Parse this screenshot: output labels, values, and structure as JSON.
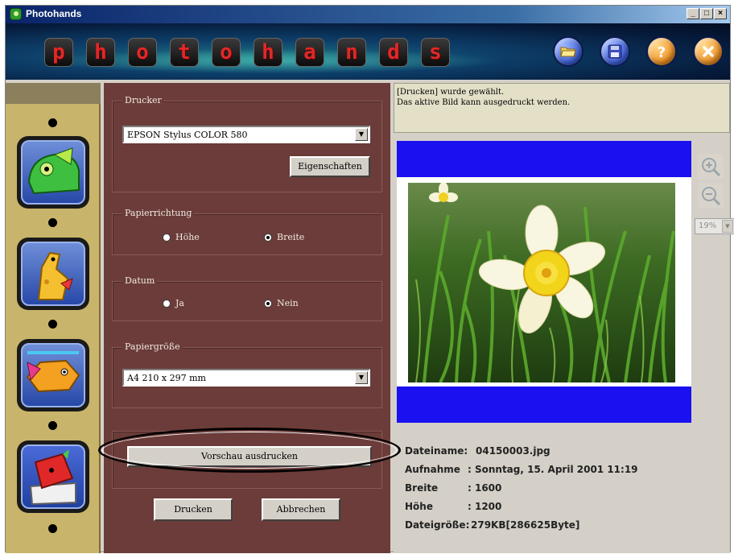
{
  "window": {
    "title": "Photohands"
  },
  "titlebar_buttons": {
    "minimize": "_",
    "maximize": "□",
    "close": "×"
  },
  "banner": {
    "logo_letters": [
      "p",
      "h",
      "o",
      "t",
      "o",
      "h",
      "a",
      "n",
      "d",
      "s"
    ],
    "toolbar_icons": [
      "open-folder-icon",
      "save-disk-icon",
      "help-icon",
      "close-icon"
    ],
    "icon_colors": {
      "blue": "#4a6adc",
      "orange": "#f09020"
    }
  },
  "sidebar": {
    "tiles": [
      "chameleon-icon",
      "giraffe-icon",
      "fish-icon",
      "printer-character-icon"
    ]
  },
  "print_panel": {
    "printer": {
      "label": "Drucker",
      "value": "EPSON Stylus COLOR 580",
      "properties_button": "Eigenschaften"
    },
    "orientation": {
      "label": "Papierrichtung",
      "options": [
        "Höhe",
        "Breite"
      ],
      "selected": "Breite"
    },
    "date": {
      "label": "Datum",
      "options": [
        "Ja",
        "Nein"
      ],
      "selected": "Nein"
    },
    "paper_size": {
      "label": "Papiergröße",
      "value": "A4 210 x 297 mm"
    },
    "preview_print_button": "Vorschau ausdrucken",
    "print_button": "Drucken",
    "cancel_button": "Abbrechen"
  },
  "message": {
    "line1": "[Drucken] wurde gewählt.",
    "line2": "Das aktive Bild kann ausgedruckt werden."
  },
  "zoom": {
    "value": "19%"
  },
  "file_info": {
    "filename_label": "Dateiname:",
    "filename": "04150003.jpg",
    "shot_label": "Aufnahme",
    "shot": ": Sonntag, 15. April 2001 11:19",
    "width_label": "Breite",
    "width": ": 1600",
    "height_label": "Höhe",
    "height": ": 1200",
    "size_label": "Dateigröße:",
    "size": "279KB[286625Byte]"
  }
}
